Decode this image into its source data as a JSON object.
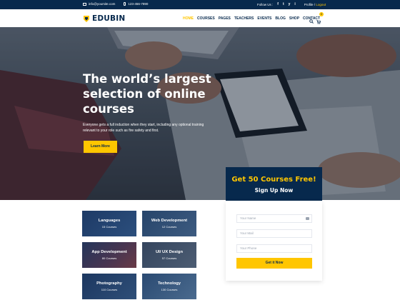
{
  "topbar": {
    "email": "info@yoursite.com",
    "phone": "123-456-7890",
    "follow_label": "Follow Us :",
    "social": [
      "f",
      "t",
      "y",
      "i"
    ],
    "profile": "Profile",
    "separator": "/",
    "logout": "Logout"
  },
  "header": {
    "logo_text": "EDUBIN",
    "nav": [
      "HOME",
      "COURSES",
      "PAGES",
      "TEACHERS",
      "EVENTS",
      "BLOG",
      "SHOP",
      "CONTACT"
    ],
    "active_nav": "HOME",
    "cart_count": "0"
  },
  "hero": {
    "title": "The world’s largest selection of online courses",
    "description": "Everyone gets a full induction when they start, including any optional training relevant to your role such as fire safety and first.",
    "button": "Learn More"
  },
  "signup": {
    "headline": "Get 50 Courses Free!",
    "subheadline": "Sign Up Now",
    "name_placeholder": "Your Name",
    "mail_placeholder": "Your Mail",
    "phone_placeholder": "Your Phone",
    "button": "Get it Now"
  },
  "categories": [
    {
      "name": "Languages",
      "count": "15 Courses"
    },
    {
      "name": "Web Development",
      "count": "12 Courses"
    },
    {
      "name": "App Development",
      "count": "80 Courses"
    },
    {
      "name": "UI/ UX Design",
      "count": "57 Courses"
    },
    {
      "name": "Photography",
      "count": "110 Courses"
    },
    {
      "name": "Technology",
      "count": "130 Courses"
    }
  ],
  "colors": {
    "navy": "#07294d",
    "accent": "#ffc600"
  }
}
